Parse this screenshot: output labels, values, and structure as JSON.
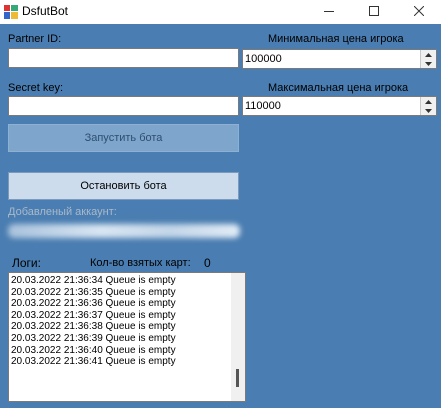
{
  "window": {
    "title": "DsfutBot"
  },
  "icons": {
    "app": "app-icon",
    "minimize": "minimize-icon",
    "maximize": "maximize-icon",
    "close": "close-icon"
  },
  "form": {
    "partner_id_label": "Partner ID:",
    "partner_id_value": "",
    "secret_key_label": "Secret key:",
    "secret_key_value": "",
    "min_price_label": "Минимальная цена игрока",
    "min_price_value": "100000",
    "max_price_label": "Максимальная цена игрока",
    "max_price_value": "110000",
    "start_button": "Запустить бота",
    "stop_button": "Остановить бота",
    "added_account_label": "Добавленый аккаунт:"
  },
  "logs": {
    "label": "Логи:",
    "cards_taken_label": "Кол-во взятых карт:",
    "cards_taken_value": "0",
    "lines": [
      "20.03.2022 21:36:34 Queue is empty",
      "20.03.2022 21:36:35 Queue is empty",
      "20.03.2022 21:36:36 Queue is empty",
      "20.03.2022 21:36:37 Queue is empty",
      "20.03.2022 21:36:38 Queue is empty",
      "20.03.2022 21:36:39 Queue is empty",
      "20.03.2022 21:36:40 Queue is empty",
      "20.03.2022 21:36:41 Queue is empty"
    ]
  }
}
